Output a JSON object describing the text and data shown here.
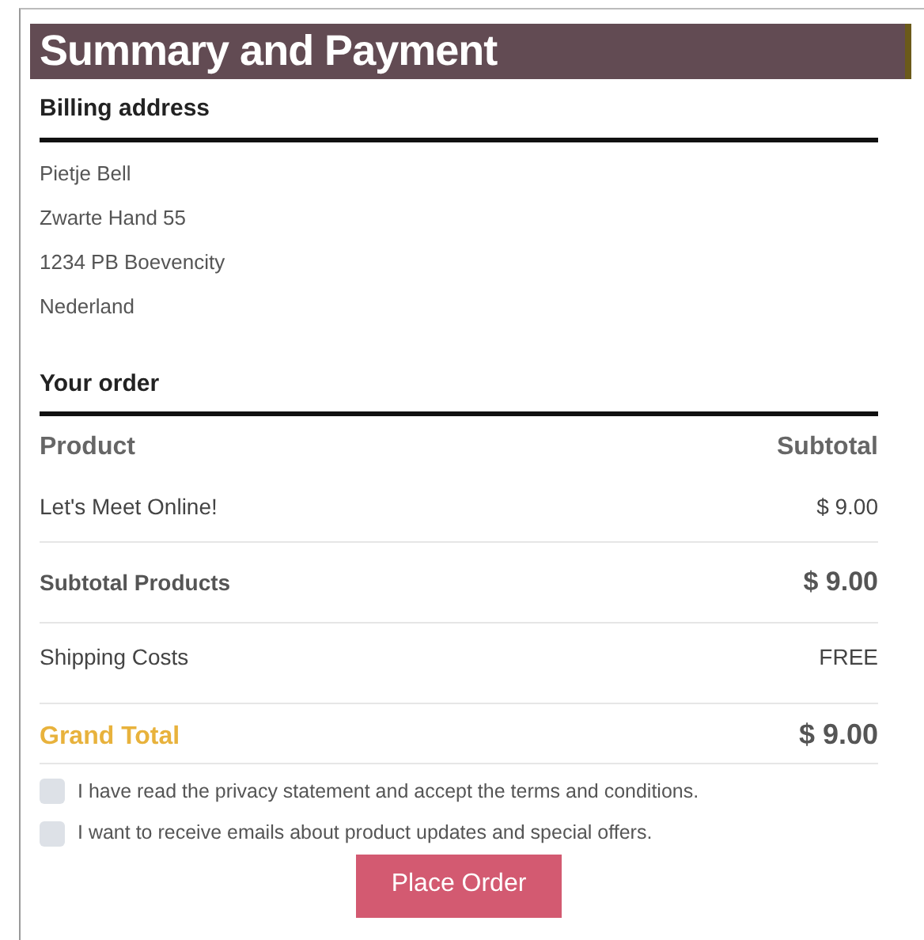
{
  "header": {
    "title": "Summary and Payment"
  },
  "billing": {
    "heading": "Billing address",
    "lines": [
      "Pietje Bell",
      "Zwarte Hand 55",
      "1234 PB Boevencity",
      "Nederland"
    ]
  },
  "order": {
    "heading": "Your order",
    "columns": [
      "Product",
      "Subtotal"
    ],
    "rows": [
      {
        "kind": "item",
        "label": "Let's Meet Online!",
        "value": "$ 9.00"
      },
      {
        "kind": "subtotal",
        "label": "Subtotal Products",
        "value": "$ 9.00"
      },
      {
        "kind": "item",
        "label": "Shipping Costs",
        "value": "FREE"
      },
      {
        "kind": "total",
        "label": "Grand Total",
        "value": "$ 9.00"
      }
    ]
  },
  "agreements": [
    {
      "label": "I have read the privacy statement and accept the terms and conditions.",
      "checked": false
    },
    {
      "label": "I want to receive emails about product updates and special offers.",
      "checked": false
    }
  ],
  "button": "Place Order"
}
